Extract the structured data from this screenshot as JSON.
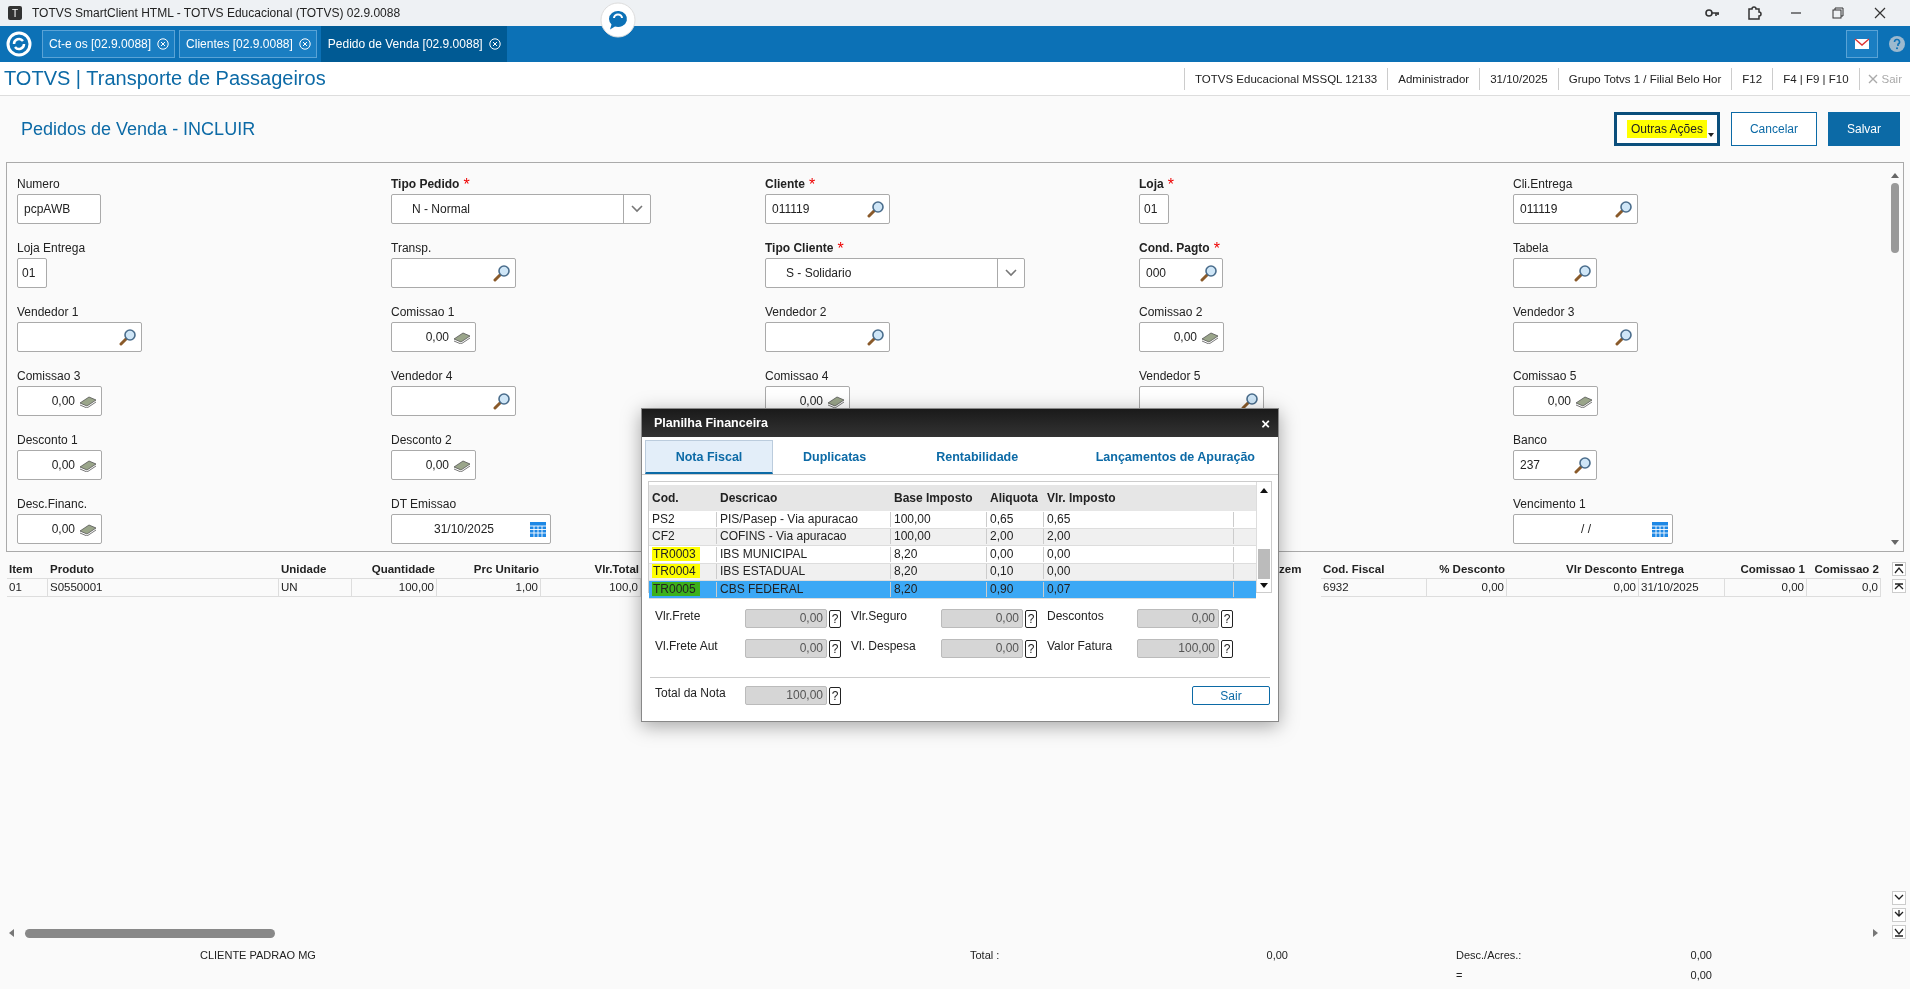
{
  "window": {
    "title": "TOTVS SmartClient HTML - TOTVS Educacional (TOTVS) 02.9.0088",
    "app_icon": "T"
  },
  "tabs": [
    {
      "label": "Ct-e os [02.9.0088]",
      "selected": false
    },
    {
      "label": "Clientes [02.9.0088]",
      "selected": false
    },
    {
      "label": "Pedido de Venda [02.9.0088]",
      "selected": true
    }
  ],
  "app_header": {
    "title": "TOTVS | Transporte de Passageiros",
    "info": [
      "TOTVS Educacional MSSQL 12133",
      "Administrador",
      "31/10/2025",
      "Grupo Totvs 1 / Filial Belo Hor",
      "F12",
      "F4 | F9 | F10"
    ],
    "exit": {
      "label": "Sair",
      "disabled": true
    }
  },
  "page": {
    "title": "Pedidos de Venda - INCLUIR",
    "actions": [
      {
        "label": "Outras Ações",
        "kind": "menu",
        "highlighted": true
      },
      {
        "label": "Cancelar",
        "kind": "outline",
        "highlighted": false
      },
      {
        "label": "Salvar",
        "kind": "primary",
        "highlighted": false
      }
    ]
  },
  "form": {
    "rows": [
      [
        {
          "label": "Numero",
          "kind": "text",
          "value": "pcpAWB"
        },
        {
          "label": "Tipo Pedido",
          "kind": "select",
          "value": "N - Normal",
          "required_mark": "*"
        },
        {
          "label": "Cliente",
          "kind": "lookup",
          "value": "011119",
          "required_mark": "*"
        },
        {
          "label": "Loja",
          "kind": "short",
          "value": "01",
          "required_mark": "*"
        },
        {
          "label": "Cli.Entrega",
          "kind": "lookup",
          "value": "011119"
        }
      ],
      [
        {
          "label": "Loja Entrega",
          "kind": "short",
          "value": "01"
        },
        {
          "label": "Transp.",
          "kind": "lookup"
        },
        {
          "label": "Tipo Cliente",
          "kind": "select",
          "value": "S - Solidario",
          "required_mark": "*"
        },
        {
          "label": "Cond. Pagto",
          "kind": "code",
          "value": "000",
          "required_mark": "*"
        },
        {
          "label": "Tabela",
          "kind": "code"
        }
      ],
      [
        {
          "label": "Vendedor 1",
          "kind": "lookup"
        },
        {
          "label": "Comissao 1",
          "kind": "money",
          "value": "0,00"
        },
        {
          "label": "Vendedor 2",
          "kind": "lookup"
        },
        {
          "label": "Comissao 2",
          "kind": "money",
          "value": "0,00"
        },
        {
          "label": "Vendedor 3",
          "kind": "lookup"
        }
      ],
      [
        {
          "label": "Comissao 3",
          "kind": "money",
          "value": "0,00"
        },
        {
          "label": "Vendedor 4",
          "kind": "lookup"
        },
        {
          "label": "Comissao 4",
          "kind": "money",
          "value": "0,00"
        },
        {
          "label": "Vendedor 5",
          "kind": "lookup"
        },
        {
          "label": "Comissao 5",
          "kind": "money",
          "value": "0,00"
        }
      ],
      [
        {
          "label": "Desconto 1",
          "kind": "money",
          "value": "0,00"
        },
        {
          "label": "Desconto 2",
          "kind": "money",
          "value": "0,00"
        },
        {
          "kind": "covered"
        },
        {
          "kind": "covered"
        },
        {
          "label": "Banco",
          "kind": "code",
          "value": "237"
        }
      ],
      [
        {
          "label": "Desc.Financ.",
          "kind": "money",
          "value": "0,00"
        },
        {
          "label": "DT Emissao",
          "kind": "date",
          "value": "31/10/2025"
        },
        {
          "kind": "covered"
        },
        {
          "kind": "covered"
        },
        {
          "label": "Vencimento 1",
          "kind": "date",
          "value": "/ /"
        }
      ]
    ]
  },
  "grid": {
    "columns": [
      "Item",
      "Produto",
      "Unidade",
      "Quantidade",
      "Prc Unitario",
      "Vlr.Total",
      "zem",
      "Cod. Fiscal",
      "% Desconto",
      "Vlr Desconto",
      "Entrega",
      "Comissao 1",
      "Comissao 2"
    ],
    "rows": [
      [
        "01",
        "S0550001",
        "UN",
        "100,00",
        "1,00",
        "100,0",
        null,
        "6932",
        "0,00",
        "0,00",
        "31/10/2025",
        "0,00",
        "0,0"
      ]
    ]
  },
  "footer": {
    "client": "CLIENTE PADRAO MG",
    "total_label": "Total :",
    "total": "0,00",
    "desc_label": "Desc./Acres.:",
    "desc": "0,00",
    "eq_label": "=",
    "eq": "0,00"
  },
  "dialog": {
    "title": "Planilha Financeira",
    "close": "×",
    "tabs": [
      {
        "label": "Nota Fiscal",
        "selected": true
      },
      {
        "label": "Duplicatas",
        "selected": false
      },
      {
        "label": "Rentabilidade",
        "selected": false
      },
      {
        "label": "Lançamentos de Apuração",
        "selected": false
      }
    ],
    "table": {
      "columns": [
        "Cod.",
        "Descricao",
        "Base Imposto",
        "Aliquota",
        "Vlr. Imposto"
      ],
      "rows": [
        {
          "cells": [
            "PS2",
            "PIS/Pasep - Via apuracao",
            "100,00",
            "0,65",
            "0,65"
          ],
          "selected": false
        },
        {
          "cells": [
            "CF2",
            "COFINS - Via apuracao",
            "100,00",
            "2,00",
            "2,00"
          ],
          "selected": false
        },
        {
          "cells": [
            "TR0003",
            "IBS MUNICIPAL",
            "8,20",
            "0,00",
            "0,00"
          ],
          "selected": false,
          "color": "#ffff00"
        },
        {
          "cells": [
            "TR0004",
            "IBS ESTADUAL",
            "8,20",
            "0,10",
            "0,00"
          ],
          "selected": false,
          "color": "#ffff00"
        },
        {
          "cells": [
            "TR0005",
            "CBS FEDERAL",
            "8,20",
            "0,90",
            "0,07"
          ],
          "selected": true,
          "color": "#3cb01a"
        }
      ]
    },
    "fields": [
      {
        "label": "Vlr.Frete",
        "value": "0,00",
        "help": "?"
      },
      {
        "label": "Vlr.Seguro",
        "value": "0,00",
        "help": "?"
      },
      {
        "label": "Descontos",
        "value": "0,00",
        "help": "?"
      },
      {
        "label": "Vl.Frete Aut",
        "value": "0,00",
        "help": "?"
      },
      {
        "label": "Vl. Despesa",
        "value": "0,00",
        "help": "?"
      },
      {
        "label": "Valor Fatura",
        "value": "100,00",
        "help": "?"
      }
    ],
    "total": {
      "label": "Total da Nota",
      "value": "100,00",
      "help": "?"
    },
    "exit_button": "Sair"
  }
}
